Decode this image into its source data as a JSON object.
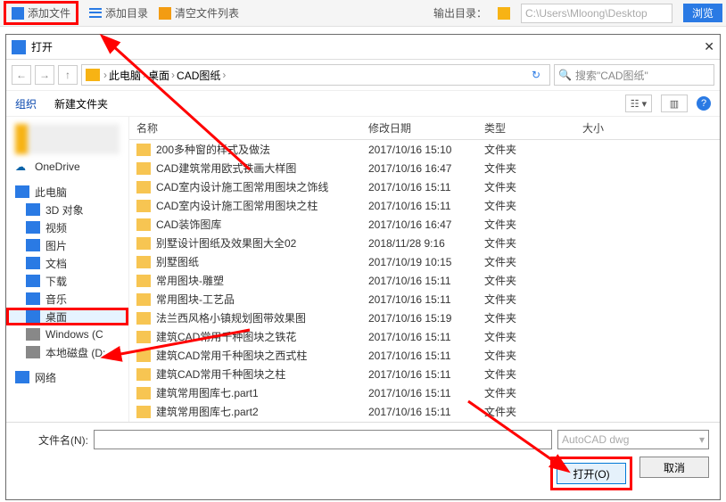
{
  "toolbar": {
    "add_file": "添加文件",
    "add_dir": "添加目录",
    "clear_list": "清空文件列表",
    "out_label": "输出目录：",
    "out_path": "C:\\Users\\Mloong\\Desktop",
    "browse": "浏览"
  },
  "dialog": {
    "title": "打开",
    "breadcrumb": [
      "此电脑",
      "桌面",
      "CAD图纸"
    ],
    "search_placeholder": "搜索\"CAD图纸\"",
    "organize": "组织",
    "new_folder": "新建文件夹",
    "filename_label": "文件名(N):",
    "type_filter": "AutoCAD dwg",
    "open_btn": "打开(O)",
    "cancel_btn": "取消"
  },
  "columns": {
    "name": "名称",
    "date": "修改日期",
    "type": "类型",
    "size": "大小"
  },
  "sidebar": [
    {
      "label": "OneDrive",
      "icon": "onedrive"
    },
    {
      "label": "此电脑",
      "icon": "pc"
    },
    {
      "label": "3D 对象",
      "icon": "blue"
    },
    {
      "label": "视频",
      "icon": "blue"
    },
    {
      "label": "图片",
      "icon": "blue"
    },
    {
      "label": "文档",
      "icon": "blue"
    },
    {
      "label": "下载",
      "icon": "blue"
    },
    {
      "label": "音乐",
      "icon": "blue"
    },
    {
      "label": "桌面",
      "icon": "blue",
      "selected": true
    },
    {
      "label": "Windows (C",
      "icon": "disk"
    },
    {
      "label": "本地磁盘 (D:",
      "icon": "disk"
    },
    {
      "label": "网络",
      "icon": "blue"
    }
  ],
  "files": [
    {
      "name": "200多种窗的样式及做法",
      "date": "2017/10/16 15:10",
      "type": "文件夹"
    },
    {
      "name": "CAD建筑常用欧式铁画大样图",
      "date": "2017/10/16 16:47",
      "type": "文件夹"
    },
    {
      "name": "CAD室内设计施工图常用图块之饰线",
      "date": "2017/10/16 15:11",
      "type": "文件夹"
    },
    {
      "name": "CAD室内设计施工图常用图块之柱",
      "date": "2017/10/16 15:11",
      "type": "文件夹"
    },
    {
      "name": "CAD装饰图库",
      "date": "2017/10/16 16:47",
      "type": "文件夹"
    },
    {
      "name": "别墅设计图纸及效果图大全02",
      "date": "2018/11/28 9:16",
      "type": "文件夹"
    },
    {
      "name": "别墅图纸",
      "date": "2017/10/19 10:15",
      "type": "文件夹"
    },
    {
      "name": "常用图块-雕塑",
      "date": "2017/10/16 15:11",
      "type": "文件夹"
    },
    {
      "name": "常用图块-工艺品",
      "date": "2017/10/16 15:11",
      "type": "文件夹"
    },
    {
      "name": "法兰西风格小镇规划图带效果图",
      "date": "2017/10/16 15:19",
      "type": "文件夹"
    },
    {
      "name": "建筑CAD常用千种图块之铁花",
      "date": "2017/10/16 15:11",
      "type": "文件夹"
    },
    {
      "name": "建筑CAD常用千种图块之西式柱",
      "date": "2017/10/16 15:11",
      "type": "文件夹"
    },
    {
      "name": "建筑CAD常用千种图块之柱",
      "date": "2017/10/16 15:11",
      "type": "文件夹"
    },
    {
      "name": "建筑常用图库七.part1",
      "date": "2017/10/16 15:11",
      "type": "文件夹"
    },
    {
      "name": "建筑常用图库七.part2",
      "date": "2017/10/16 15:11",
      "type": "文件夹"
    }
  ]
}
